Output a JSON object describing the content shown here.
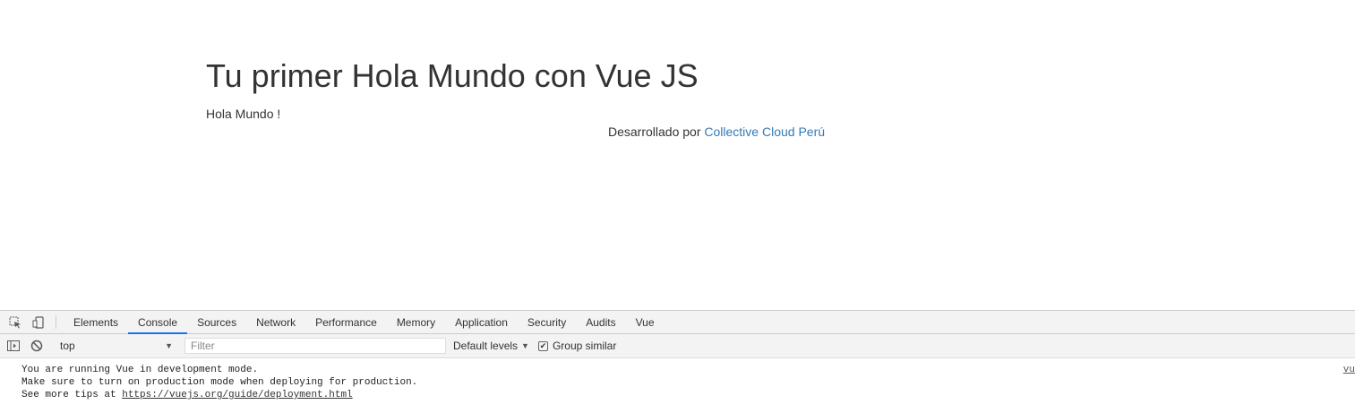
{
  "page": {
    "title": "Tu primer Hola Mundo con Vue JS",
    "message": "Hola Mundo !",
    "footer_prefix": "Desarrollado por ",
    "footer_link": "Collective Cloud Perú"
  },
  "devtools": {
    "tabs": [
      {
        "label": "Elements"
      },
      {
        "label": "Console"
      },
      {
        "label": "Sources"
      },
      {
        "label": "Network"
      },
      {
        "label": "Performance"
      },
      {
        "label": "Memory"
      },
      {
        "label": "Application"
      },
      {
        "label": "Security"
      },
      {
        "label": "Audits"
      },
      {
        "label": "Vue"
      }
    ],
    "active_tab": "Console",
    "context": "top",
    "filter_placeholder": "Filter",
    "levels": "Default levels",
    "group_similar": "Group similar",
    "group_similar_checked": true,
    "console": {
      "line1": "You are running Vue in development mode.",
      "line2": "Make sure to turn on production mode when deploying for production.",
      "line3_prefix": "See more tips at ",
      "line3_link": "https://vuejs.org/guide/deployment.html",
      "source": "vu"
    }
  }
}
